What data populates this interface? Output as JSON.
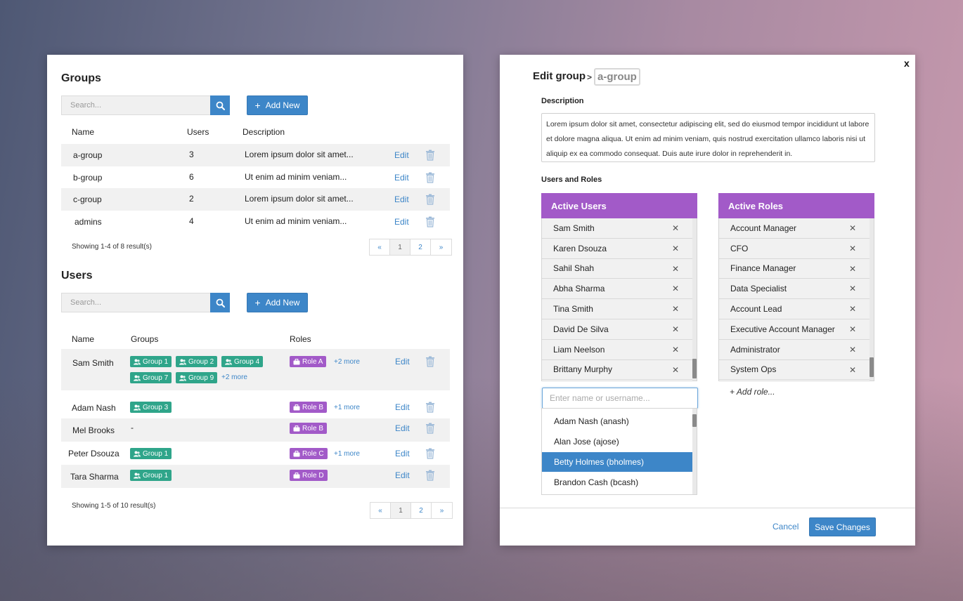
{
  "groups": {
    "title": "Groups",
    "search_placeholder": "Search...",
    "add_label": "Add New",
    "headers": {
      "name": "Name",
      "users": "Users",
      "description": "Description"
    },
    "rows": [
      {
        "name": "a-group",
        "users": "3",
        "description": "Lorem ipsum dolor sit amet...",
        "edit": "Edit"
      },
      {
        "name": "b-group",
        "users": "6",
        "description": "Ut enim ad minim veniam...",
        "edit": "Edit"
      },
      {
        "name": "c-group",
        "users": "2",
        "description": "Lorem ipsum dolor sit amet...",
        "edit": "Edit"
      },
      {
        "name": "admins",
        "users": "4",
        "description": "Ut enim ad minim veniam...",
        "edit": "Edit"
      }
    ],
    "showing": "Showing 1-4 of 8 result(s)",
    "pager": [
      "«",
      "1",
      "2",
      "»"
    ]
  },
  "users": {
    "title": "Users",
    "search_placeholder": "Search...",
    "add_label": "Add New",
    "headers": {
      "name": "Name",
      "groups": "Groups",
      "roles": "Roles"
    },
    "rows": [
      {
        "name": "Sam Smith",
        "groups": [
          "Group 1",
          "Group 2",
          "Group 4",
          "Group 7",
          "Group 9"
        ],
        "groups_more": "+2 more",
        "roles": [
          "Role A"
        ],
        "roles_more": "+2 more",
        "edit": "Edit"
      },
      {
        "name": "Adam Nash",
        "groups": [
          "Group 3"
        ],
        "roles": [
          "Role B"
        ],
        "roles_more": "+1 more",
        "edit": "Edit"
      },
      {
        "name": "Mel Brooks",
        "groups_text": "-",
        "roles": [
          "Role B"
        ],
        "edit": "Edit"
      },
      {
        "name": "Peter Dsouza",
        "groups": [
          "Group 1"
        ],
        "roles": [
          "Role C"
        ],
        "roles_more": "+1 more",
        "edit": "Edit"
      },
      {
        "name": "Tara Sharma",
        "groups": [
          "Group 1"
        ],
        "roles": [
          "Role D"
        ],
        "edit": "Edit"
      }
    ],
    "showing": "Showing 1-5 of 10 result(s)",
    "pager": [
      "«",
      "1",
      "2",
      "»"
    ]
  },
  "edit_group": {
    "close": "x",
    "title": "Edit group",
    "separator": ">",
    "group_name": "a-group",
    "description_label": "Description",
    "description": "Lorem ipsum dolor sit amet, consectetur adipiscing elit, sed do eiusmod tempor incididunt ut labore et dolore magna aliqua. Ut enim ad minim veniam, quis nostrud exercitation ullamco laboris nisi ut aliquip ex ea commodo consequat. Duis aute irure dolor in reprehenderit in.",
    "users_roles_label": "Users and Roles",
    "active_users_title": "Active Users",
    "active_users": [
      "Sam Smith",
      "Karen Dsouza",
      "Sahil Shah",
      "Abha Sharma",
      "Tina Smith",
      "David De Silva",
      "Liam Neelson",
      "Brittany Murphy"
    ],
    "active_roles_title": "Active Roles",
    "active_roles": [
      "Account Manager",
      "CFO",
      "Finance Manager",
      "Data Specialist",
      "Account Lead",
      "Executive Account Manager",
      "Administrator",
      "System Ops"
    ],
    "remove_glyph": "✕",
    "user_input_placeholder": "Enter name or username...",
    "suggestions": [
      "Adam Nash (anash)",
      "Alan Jose (ajose)",
      "Betty Holmes (bholmes)",
      "Brandon Cash (bcash)"
    ],
    "selected_suggestion": "Betty Holmes (bholmes)",
    "add_role": "+ Add role...",
    "cancel": "Cancel",
    "save": "Save Changes"
  },
  "colors": {
    "primary": "#3d86c8",
    "group_tag": "#2fa58a",
    "role_tag": "#a25ac8",
    "list_header": "#a25ac8"
  },
  "icons": {
    "search": "search-icon",
    "trash": "trash-icon",
    "plus": "plus-icon",
    "group_tag": "users-icon",
    "role_tag": "briefcase-icon",
    "remove": "close-icon"
  }
}
